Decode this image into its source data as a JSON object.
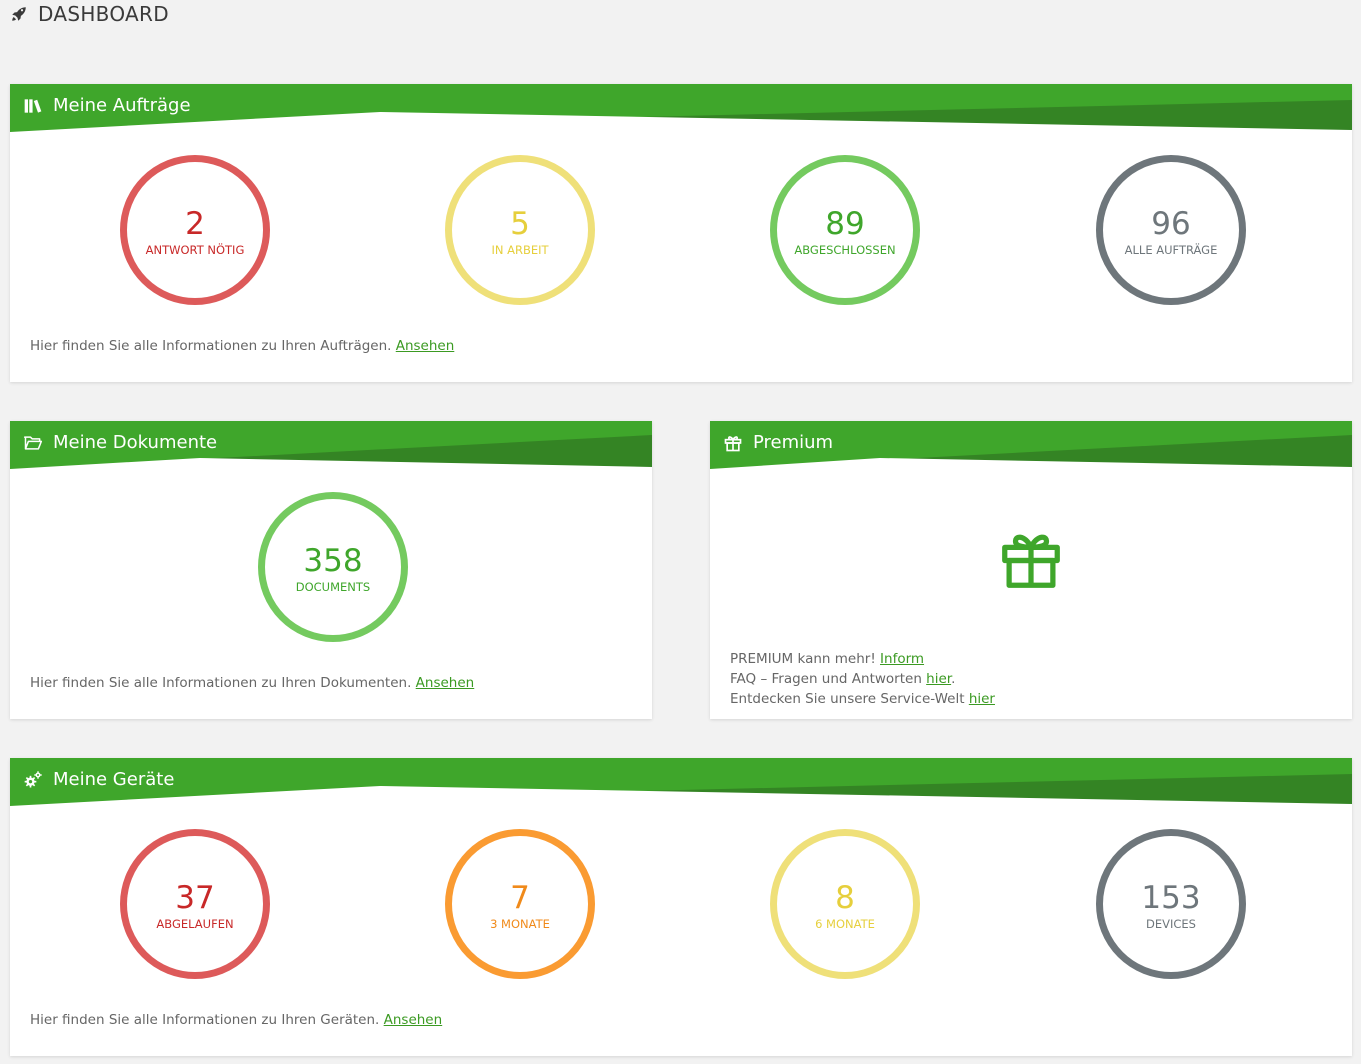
{
  "header": {
    "title": "DASHBOARD",
    "icon": "rocket-icon"
  },
  "colors": {
    "green_band": "#3fa62b",
    "green_dark": "#348424",
    "red": "#dd5a5a",
    "yellow": "#efe079",
    "green": "#74ca5f",
    "gray": "#6e767b",
    "orange": "#fa9b32"
  },
  "auftraege": {
    "title": "Meine Aufträge",
    "icon": "books-icon",
    "stats": [
      {
        "value": "2",
        "label": "ANTWORT NÖTIG"
      },
      {
        "value": "5",
        "label": "IN ARBEIT"
      },
      {
        "value": "89",
        "label": "ABGESCHLOSSEN"
      },
      {
        "value": "96",
        "label": "ALLE AUFTRÄGE"
      }
    ],
    "info_text": "Hier finden Sie alle Informationen zu Ihren Aufträgen. ",
    "link": "Ansehen"
  },
  "dokumente": {
    "title": "Meine Dokumente",
    "icon": "folder-open-icon",
    "stat": {
      "value": "358",
      "label": "DOCUMENTS"
    },
    "info_text": "Hier finden Sie alle Informationen zu Ihren Dokumenten. ",
    "link": "Ansehen"
  },
  "premium": {
    "title": "Premium",
    "icon": "gift-icon",
    "line1_text": "PREMIUM kann mehr! ",
    "line1_link": "Inform",
    "line2_text": "FAQ – Fragen und Antworten ",
    "line2_link": "hier",
    "line2_after": ".",
    "line3_text": "Entdecken Sie unsere Service-Welt ",
    "line3_link": "hier"
  },
  "geraete": {
    "title": "Meine Geräte",
    "icon": "cogs-icon",
    "stats": [
      {
        "value": "37",
        "label": "ABGELAUFEN"
      },
      {
        "value": "7",
        "label": "3 MONATE"
      },
      {
        "value": "8",
        "label": "6 MONATE"
      },
      {
        "value": "153",
        "label": "DEVICES"
      }
    ],
    "info_text": "Hier finden Sie alle Informationen zu Ihren Geräten. ",
    "link": "Ansehen"
  }
}
